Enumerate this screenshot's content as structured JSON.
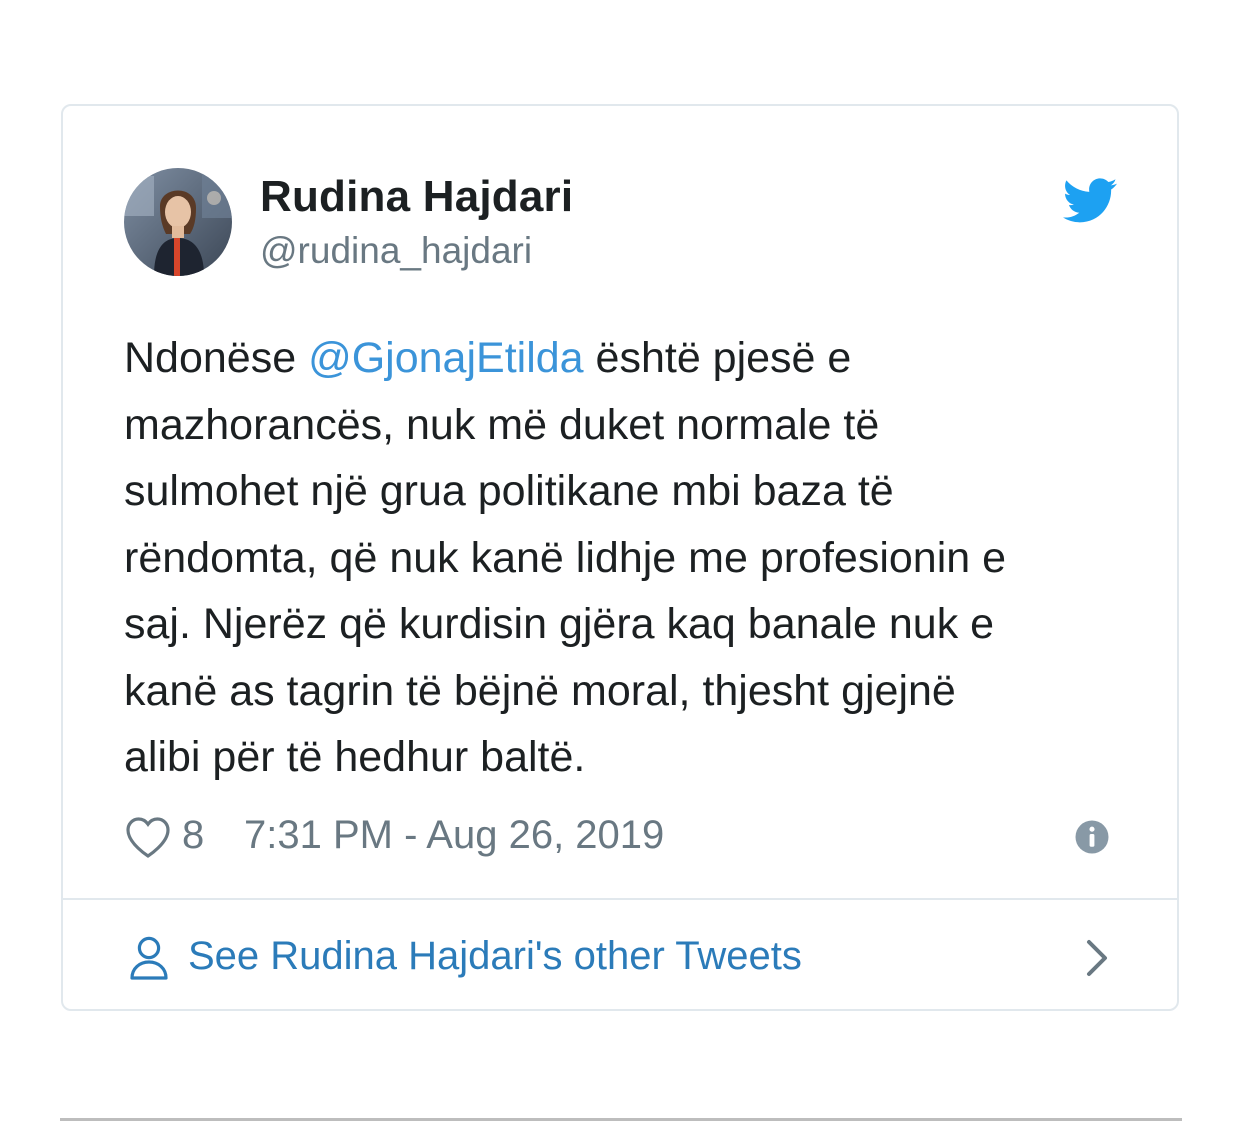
{
  "tweet": {
    "author": {
      "name": "Rudina Hajdari",
      "handle": "@rudina_hajdari",
      "avatar_icon": "avatar-photo"
    },
    "brand_icon": "twitter-bird-icon",
    "brand_color": "#1da1f2",
    "text_lines": [
      {
        "before": "Ndonëse ",
        "mention": "@GjonajEtilda",
        "after": " është pjesë e"
      },
      {
        "text": "mazhorancës, nuk më duket normale të"
      },
      {
        "text": "sulmohet një grua politikane mbi baza të"
      },
      {
        "text": "rëndomta, që nuk kanë lidhje me profesionin e"
      },
      {
        "text": "saj. Njerëz që kurdisin gjëra kaq banale nuk e"
      },
      {
        "text": "kanë as tagrin të bëjnë moral, thjesht gjejnë"
      },
      {
        "text": "alibi për të hedhur baltë."
      }
    ],
    "likes": "8",
    "timestamp": "7:31 PM - Aug 26, 2019",
    "icons": {
      "like": "heart-icon",
      "info": "info-icon",
      "profile": "person-icon",
      "more": "chevron-right-icon"
    },
    "footer_link": "See Rudina Hajdari's other Tweets",
    "link_color": "#2b7bb9",
    "mention_color": "#3b94d9"
  }
}
